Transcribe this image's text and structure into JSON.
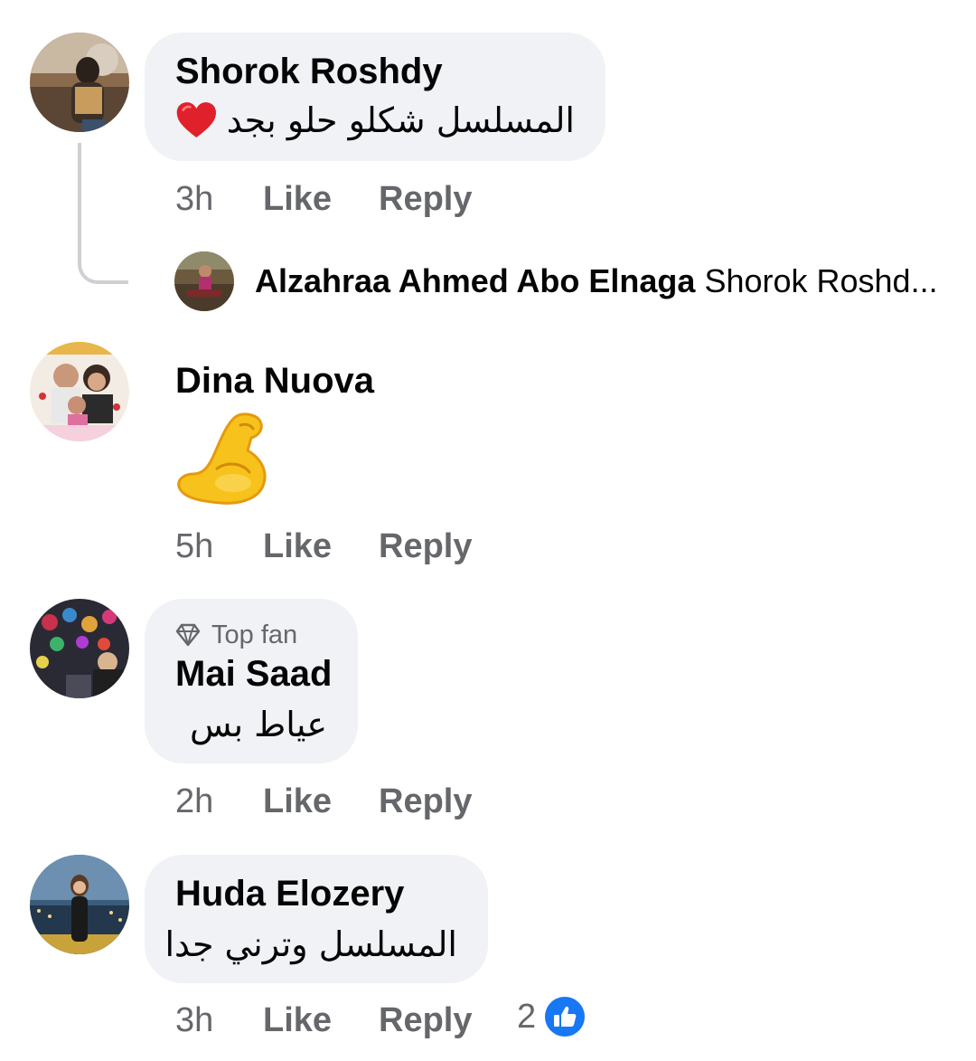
{
  "comments": [
    {
      "name": "Shorok Roshdy",
      "text": "المسلسل شكلو حلو بجد",
      "emoji": "heart",
      "time": "3h",
      "like": "Like",
      "reply": "Reply"
    },
    {
      "name": "Dina Nuova",
      "emoji": "flexed-biceps",
      "time": "5h",
      "like": "Like",
      "reply": "Reply"
    },
    {
      "badge": "Top fan",
      "name": "Mai Saad",
      "text": "عياط بس",
      "time": "2h",
      "like": "Like",
      "reply": "Reply"
    },
    {
      "name": "Huda Elozery",
      "text": "المسلسل وترني جدا",
      "time": "3h",
      "like": "Like",
      "reply": "Reply",
      "reactions": "2"
    }
  ],
  "reply_preview": {
    "name": "Alzahraa Ahmed Abo Elnaga",
    "text": "Shorok Roshd..."
  },
  "colors": {
    "bubble": "#f0f2f5",
    "secondary_text": "#65676b",
    "like_blue": "#1877f2",
    "heart_red": "#e0202b"
  }
}
